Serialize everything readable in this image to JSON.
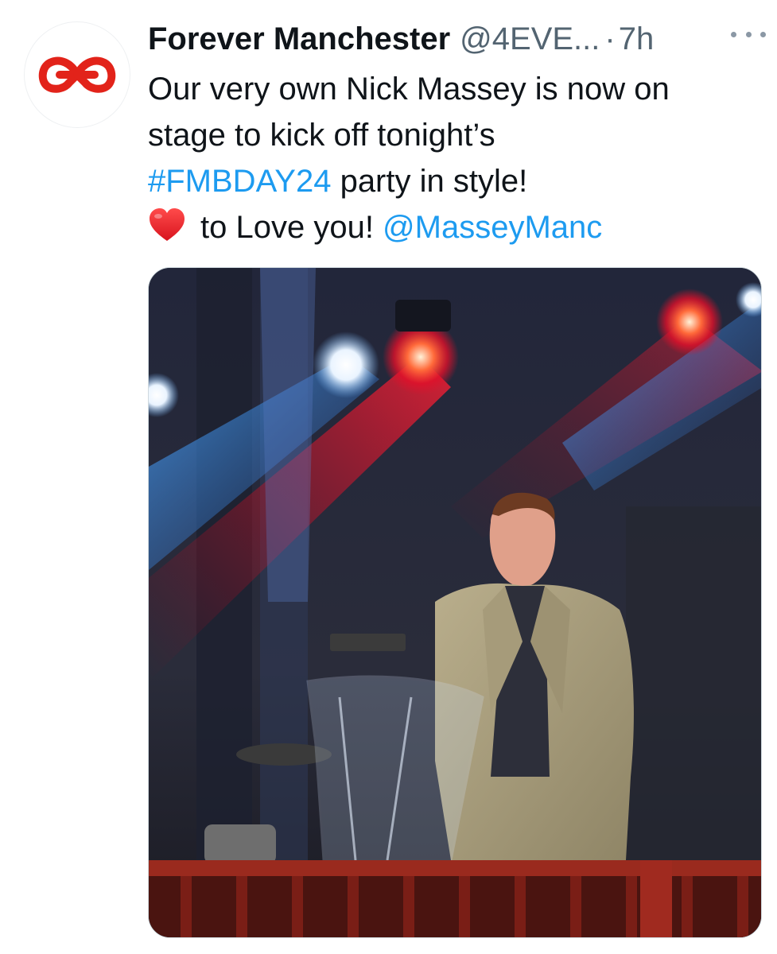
{
  "tweet": {
    "display_name": "Forever Manchester",
    "handle": "@4EVE...",
    "separator": "·",
    "time": "7h",
    "more_icon": "more-horizontal-icon",
    "avatar_icon": "forever-manchester-logo",
    "body": {
      "line1": "Our very own Nick Massey is now on",
      "line2": "stage to kick off tonight’s",
      "hashtag": "#FMBDAY24",
      "line3_rest": " party in style!",
      "heart_icon": "red-heart-emoji",
      "line4_text": "to Love you! ",
      "mention": "@MasseyManc"
    },
    "media": {
      "type": "photo",
      "icon": "stage-photo"
    },
    "colors": {
      "link": "#1d9bf0",
      "text": "#0f1419",
      "secondary": "#536471",
      "brand_red": "#e2231a"
    }
  }
}
